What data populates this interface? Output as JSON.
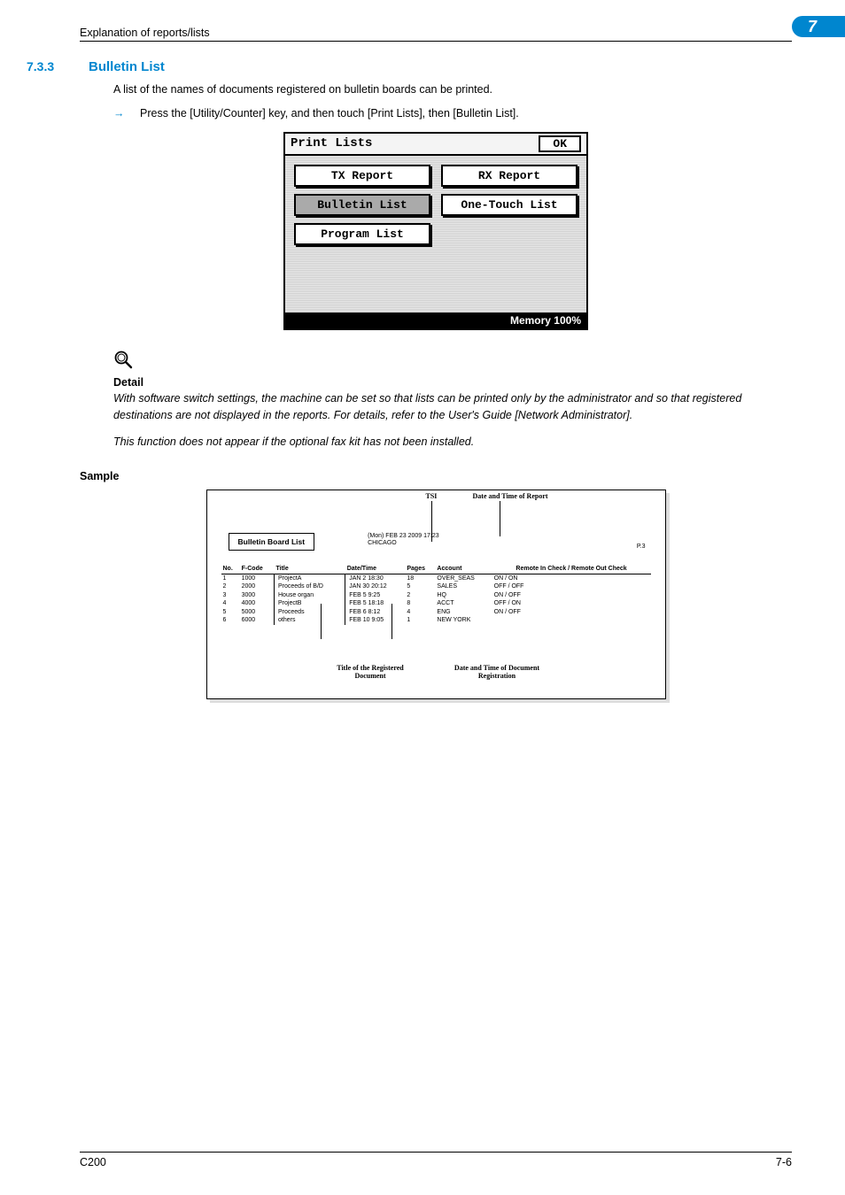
{
  "header": {
    "title": "Explanation of reports/lists"
  },
  "chapter": {
    "num": "7"
  },
  "section": {
    "num": "7.3.3",
    "title": "Bulletin List"
  },
  "body": {
    "intro": "A list of the names of documents registered on bulletin boards can be printed.",
    "step_arrow": "→",
    "step1": "Press the [Utility/Counter] key, and then touch [Print Lists], then [Bulletin List]."
  },
  "lcd": {
    "title": "Print Lists",
    "ok": "OK",
    "btn_tx": "TX Report",
    "btn_rx": "RX Report",
    "btn_bulletin": "Bulletin List",
    "btn_onetouch": "One-Touch List",
    "btn_program": "Program List",
    "footer": "Memory 100%"
  },
  "note": {
    "heading": "Detail",
    "para1": "With software switch settings, the machine can be set so that lists can be printed only by the administrator and so that registered destinations are not displayed in the reports. For details, refer to the User's Guide [Network Administrator].",
    "para2": "This function does not appear if the optional fax kit has not been installed."
  },
  "sample": {
    "label": "Sample"
  },
  "report": {
    "leader_tsi": "TSI",
    "leader_datetime": "Date and Time of Report",
    "pagenum": "P.3",
    "titlebox": "Bulletin Board List",
    "meta_date": "(Mon) FEB 23 2009 17:23",
    "meta_tsi": "CHICAGO",
    "headers": {
      "no": "No.",
      "fcode": "F-Code",
      "title": "Title",
      "datetime": "Date/Time",
      "pages": "Pages",
      "account": "Account",
      "remote": "Remote In Check / Remote Out Check"
    },
    "rows": [
      {
        "no": "1",
        "fcode": "1000",
        "title": "ProjectA",
        "datetime": "JAN   2 18:30",
        "pages": "18",
        "account": "OVER_SEAS",
        "remote": "ON / ON"
      },
      {
        "no": "2",
        "fcode": "2000",
        "title": "Proceeds of B/D",
        "datetime": "JAN  30 20:12",
        "pages": "5",
        "account": "SALES",
        "remote": "OFF / OFF"
      },
      {
        "no": "3",
        "fcode": "3000",
        "title": "House organ",
        "datetime": "FEB   5  9:25",
        "pages": "2",
        "account": "HQ",
        "remote": "ON / OFF"
      },
      {
        "no": "4",
        "fcode": "4000",
        "title": "ProjectB",
        "datetime": "FEB   5 18:18",
        "pages": "8",
        "account": "ACCT",
        "remote": "OFF / ON"
      },
      {
        "no": "5",
        "fcode": "5000",
        "title": "Proceeds",
        "datetime": "FEB   6  8:12",
        "pages": "4",
        "account": "ENG",
        "remote": "ON / OFF"
      },
      {
        "no": "6",
        "fcode": "6000",
        "title": "others",
        "datetime": "FEB  10  9:05",
        "pages": "1",
        "account": "NEW YORK",
        "remote": ""
      }
    ],
    "annot_title": "Title of the Registered Document",
    "annot_date": "Date and Time of Document Registration"
  },
  "footer": {
    "left": "C200",
    "right": "7-6"
  }
}
